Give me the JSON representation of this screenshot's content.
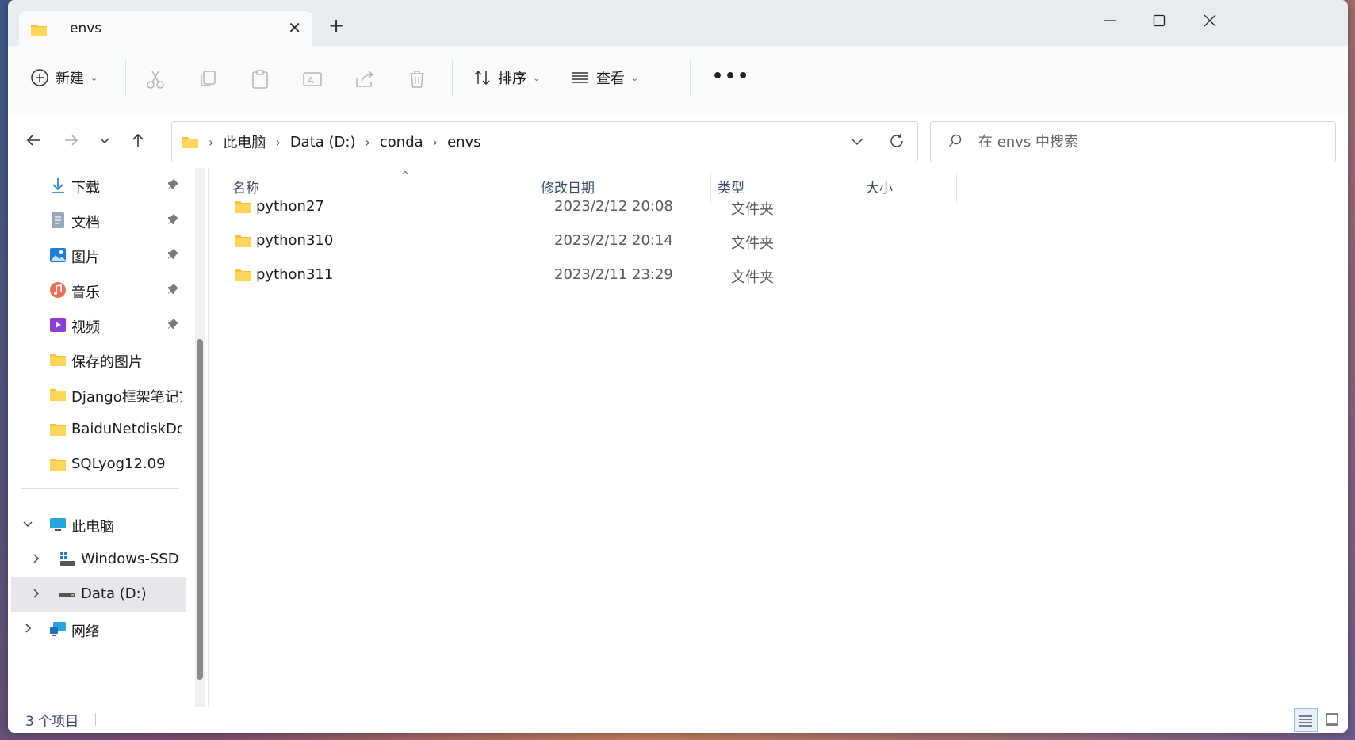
{
  "tab": {
    "title": "envs",
    "new_tab": "+",
    "close": "✕"
  },
  "toolbar": {
    "new_label": "新建",
    "sort_label": "排序",
    "view_label": "查看",
    "more_label": "•••"
  },
  "nav": {
    "breadcrumbs": [
      "此电脑",
      "Data (D:)",
      "conda",
      "envs"
    ],
    "search_placeholder": "在 envs 中搜索"
  },
  "sidebar": {
    "quick": [
      {
        "label": "下载",
        "icon": "download-icon"
      },
      {
        "label": "文档",
        "icon": "document-icon"
      },
      {
        "label": "图片",
        "icon": "pictures-icon"
      },
      {
        "label": "音乐",
        "icon": "music-icon"
      },
      {
        "label": "视频",
        "icon": "video-icon"
      },
      {
        "label": "保存的图片",
        "icon": "folder-icon"
      },
      {
        "label": "Django框架笔记文",
        "icon": "folder-icon"
      },
      {
        "label": "BaiduNetdiskDow",
        "icon": "folder-icon"
      },
      {
        "label": "SQLyog12.09",
        "icon": "folder-icon"
      }
    ],
    "this_pc": "此电脑",
    "drives": [
      "Windows-SSD (",
      "Data (D:)"
    ],
    "network": "网络"
  },
  "columns": {
    "name": "名称",
    "modified": "修改日期",
    "type": "类型",
    "size": "大小"
  },
  "files": [
    {
      "name": "python27",
      "modified": "2023/2/12 20:08",
      "type": "文件夹"
    },
    {
      "name": "python310",
      "modified": "2023/2/12 20:14",
      "type": "文件夹"
    },
    {
      "name": "python311",
      "modified": "2023/2/11 23:29",
      "type": "文件夹"
    }
  ],
  "status": {
    "item_count": "3 个项目"
  },
  "colors": {
    "accent": "#0067c0",
    "folder": "#f8c33a"
  }
}
